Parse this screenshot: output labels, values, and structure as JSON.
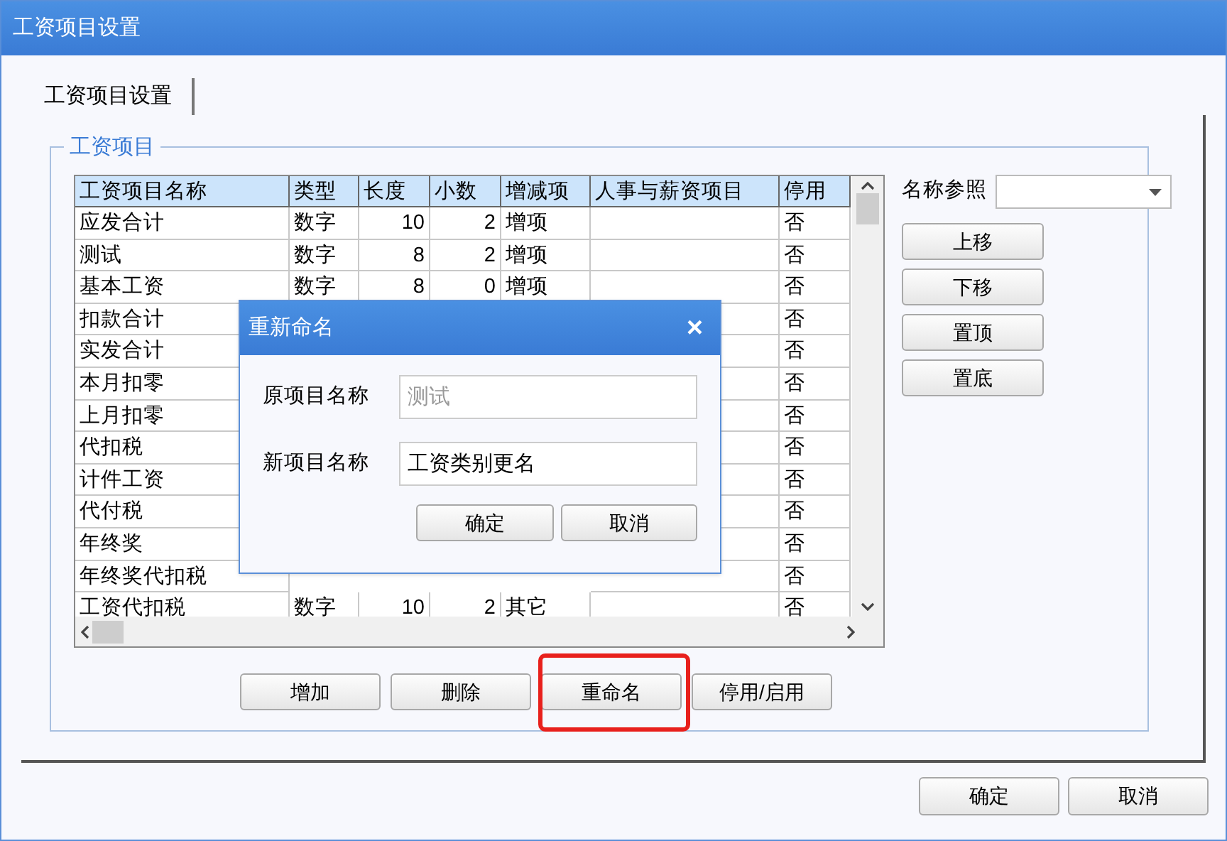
{
  "window": {
    "title": "工资项目设置"
  },
  "tabs": [
    {
      "label": "工资项目设置",
      "selected": true
    }
  ],
  "group": {
    "title": "工资项目"
  },
  "table": {
    "columns": [
      "工资项目名称",
      "类型",
      "长度",
      "小数",
      "增减项",
      "人事与薪资项目",
      "停用"
    ],
    "rows": [
      {
        "name": "应发合计",
        "type": "数字",
        "length": "10",
        "decimals": "2",
        "sign": "增项",
        "disabled": "否"
      },
      {
        "name": "测试",
        "type": "数字",
        "length": "8",
        "decimals": "2",
        "sign": "增项",
        "disabled": "否"
      },
      {
        "name": "基本工资",
        "type": "数字",
        "length": "8",
        "decimals": "0",
        "sign": "增项",
        "disabled": "否"
      },
      {
        "name": "扣款合计",
        "disabled": "否"
      },
      {
        "name": "实发合计",
        "disabled": "否"
      },
      {
        "name": "本月扣零",
        "disabled": "否"
      },
      {
        "name": "上月扣零",
        "disabled": "否"
      },
      {
        "name": "代扣税",
        "disabled": "否"
      },
      {
        "name": "计件工资",
        "disabled": "否"
      },
      {
        "name": "代付税",
        "disabled": "否"
      },
      {
        "name": "年终奖",
        "disabled": "否"
      },
      {
        "name": "年终奖代扣税",
        "disabled": "否"
      },
      {
        "name": "工资代扣税",
        "type": "数字",
        "length": "10",
        "decimals": "2",
        "sign": "其它",
        "disabled": "否"
      }
    ]
  },
  "name_reference": {
    "label": "名称参照"
  },
  "side_buttons": [
    "上移",
    "下移",
    "置顶",
    "置底"
  ],
  "action_buttons": [
    {
      "label": "增加",
      "highlighted": false
    },
    {
      "label": "删除",
      "highlighted": false
    },
    {
      "label": "重命名",
      "highlighted": true
    },
    {
      "label": "停用/启用",
      "highlighted": false
    }
  ],
  "footer_buttons": [
    "确定",
    "取消"
  ],
  "dialog": {
    "title": "重新命名",
    "close": "×",
    "fields": [
      {
        "label": "原项目名称",
        "placeholder": "测试"
      },
      {
        "label": "新项目名称",
        "value": "工资类别更名"
      }
    ],
    "buttons": [
      "确定",
      "取消"
    ]
  }
}
